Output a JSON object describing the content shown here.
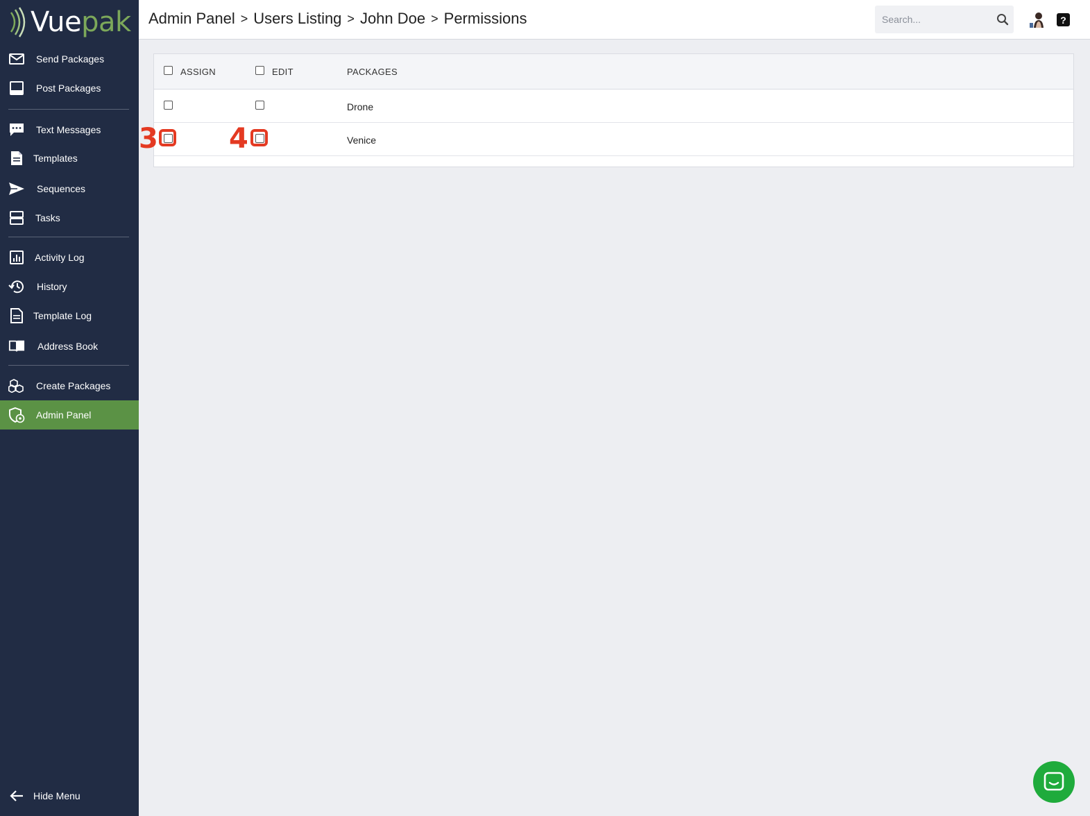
{
  "brand": {
    "name_part1": "Vue",
    "name_part2": "pak",
    "accent_color": "#7ca85a"
  },
  "sidebar": {
    "items": [
      {
        "label": "Send Packages",
        "icon": "envelope-icon"
      },
      {
        "label": "Post Packages",
        "icon": "monitor-icon"
      },
      {
        "label": "Text Messages",
        "icon": "chat-bubble-icon"
      },
      {
        "label": "Templates",
        "icon": "document-icon"
      },
      {
        "label": "Sequences",
        "icon": "paper-plane-icon"
      },
      {
        "label": "Tasks",
        "icon": "tasks-icon"
      },
      {
        "label": "Activity Log",
        "icon": "bar-chart-icon"
      },
      {
        "label": "History",
        "icon": "history-icon"
      },
      {
        "label": "Template Log",
        "icon": "document-icon"
      },
      {
        "label": "Address Book",
        "icon": "book-icon"
      },
      {
        "label": "Create Packages",
        "icon": "boxes-icon"
      },
      {
        "label": "Admin Panel",
        "icon": "admin-shield-icon",
        "active": true
      }
    ],
    "hide_menu_label": "Hide Menu",
    "background_color": "#212c44",
    "active_color": "#5b9245"
  },
  "header": {
    "breadcrumb": [
      "Admin Panel",
      "Users Listing",
      "John Doe",
      "Permissions"
    ],
    "breadcrumb_separator": ">",
    "search_placeholder": "Search...",
    "help_label": "?"
  },
  "table": {
    "columns": {
      "assign": "ASSIGN",
      "edit": "EDIT",
      "packages": "PACKAGES"
    },
    "rows": [
      {
        "package": "Drone",
        "assign": false,
        "edit": false
      },
      {
        "package": "Venice",
        "assign": false,
        "edit": false
      }
    ]
  },
  "annotations": {
    "marker_assign": "3",
    "marker_edit": "4",
    "marker_color": "#e43a22"
  },
  "chat": {
    "color": "#1fab3c"
  }
}
